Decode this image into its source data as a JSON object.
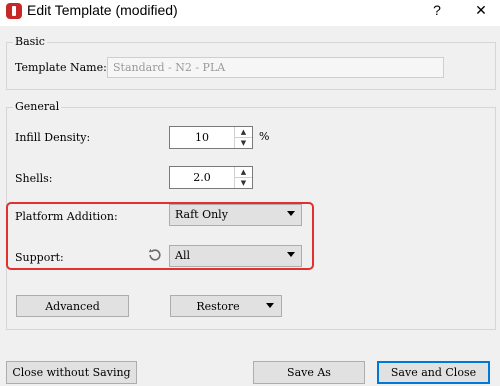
{
  "window": {
    "title": "Edit Template (modified)",
    "help_label": "?",
    "close_label": "✕"
  },
  "basic": {
    "legend": "Basic",
    "template_name_label": "Template Name:",
    "template_name_value": "Standard - N2 - PLA"
  },
  "general": {
    "legend": "General",
    "infill_label": "Infill Density:",
    "infill_value": "10",
    "infill_unit": "%",
    "shells_label": "Shells:",
    "shells_value": "2.0",
    "platform_label": "Platform Addition:",
    "platform_value": "Raft Only",
    "support_label": "Support:",
    "support_value": "All",
    "advanced_label": "Advanced",
    "restore_label": "Restore"
  },
  "footer": {
    "close_without_saving": "Close without Saving",
    "save_as": "Save As",
    "save_and_close": "Save and Close"
  },
  "icons": {
    "spin_up": "▲",
    "spin_down": "▼"
  },
  "colors": {
    "highlight_border": "#e03030",
    "default_button_border": "#0078d7",
    "app_icon": "#c62828"
  }
}
